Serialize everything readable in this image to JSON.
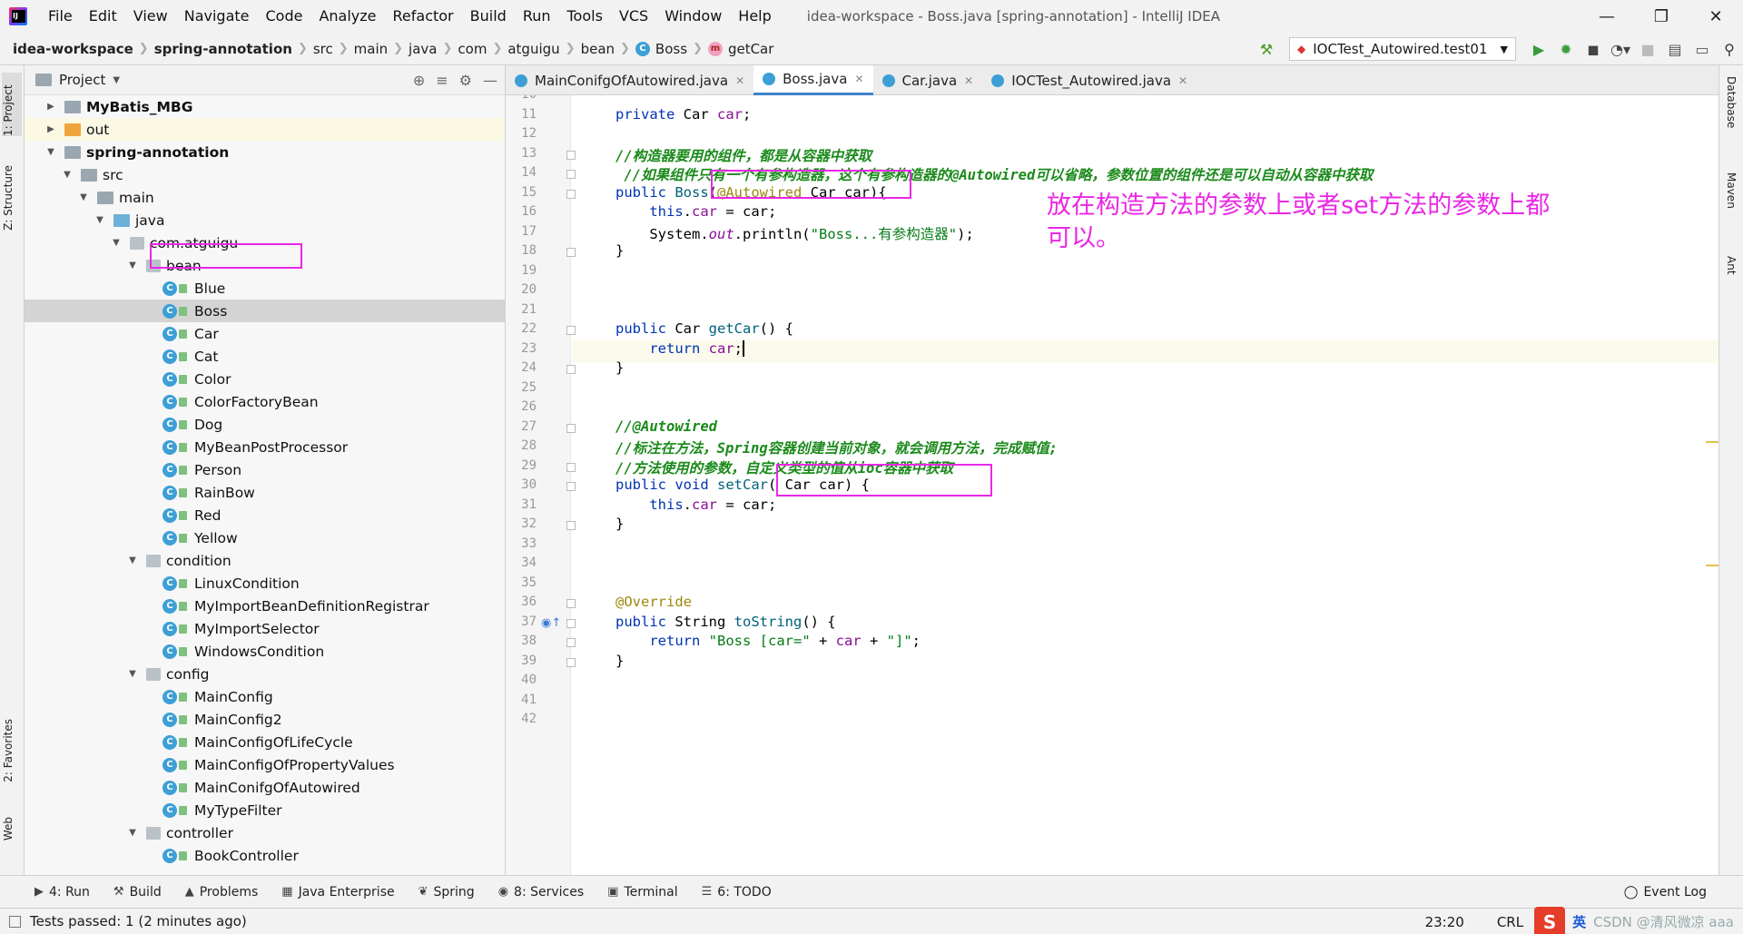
{
  "menu": {
    "items": [
      "File",
      "Edit",
      "View",
      "Navigate",
      "Code",
      "Analyze",
      "Refactor",
      "Build",
      "Run",
      "Tools",
      "VCS",
      "Window",
      "Help"
    ],
    "window_title": "idea-workspace - Boss.java [spring-annotation] - IntelliJ IDEA"
  },
  "breadcrumb": [
    "idea-workspace",
    "spring-annotation",
    "src",
    "main",
    "java",
    "com",
    "atguigu",
    "bean",
    "Boss",
    "getCar"
  ],
  "run_config": "IOCTest_Autowired.test01",
  "project_panel": {
    "title": "Project",
    "tree": [
      {
        "label": "MyBatis_MBG",
        "level": 0,
        "type": "project",
        "arrow": "right",
        "bold": true
      },
      {
        "label": "out",
        "level": 0,
        "type": "folder-orange",
        "arrow": "right",
        "highlight": true
      },
      {
        "label": "spring-annotation",
        "level": 0,
        "type": "project",
        "arrow": "down",
        "bold": true
      },
      {
        "label": "src",
        "level": 1,
        "type": "folder",
        "arrow": "down"
      },
      {
        "label": "main",
        "level": 2,
        "type": "folder",
        "arrow": "down"
      },
      {
        "label": "java",
        "level": 3,
        "type": "folder-blue",
        "arrow": "down"
      },
      {
        "label": "com.atguigu",
        "level": 4,
        "type": "package",
        "arrow": "down"
      },
      {
        "label": "bean",
        "level": 5,
        "type": "package",
        "arrow": "down"
      },
      {
        "label": "Blue",
        "level": 6,
        "type": "class"
      },
      {
        "label": "Boss",
        "level": 6,
        "type": "class",
        "selected": true
      },
      {
        "label": "Car",
        "level": 6,
        "type": "class"
      },
      {
        "label": "Cat",
        "level": 6,
        "type": "class"
      },
      {
        "label": "Color",
        "level": 6,
        "type": "class"
      },
      {
        "label": "ColorFactoryBean",
        "level": 6,
        "type": "class"
      },
      {
        "label": "Dog",
        "level": 6,
        "type": "class"
      },
      {
        "label": "MyBeanPostProcessor",
        "level": 6,
        "type": "class"
      },
      {
        "label": "Person",
        "level": 6,
        "type": "class"
      },
      {
        "label": "RainBow",
        "level": 6,
        "type": "class"
      },
      {
        "label": "Red",
        "level": 6,
        "type": "class"
      },
      {
        "label": "Yellow",
        "level": 6,
        "type": "class"
      },
      {
        "label": "condition",
        "level": 5,
        "type": "package",
        "arrow": "down"
      },
      {
        "label": "LinuxCondition",
        "level": 6,
        "type": "class"
      },
      {
        "label": "MyImportBeanDefinitionRegistrar",
        "level": 6,
        "type": "class"
      },
      {
        "label": "MyImportSelector",
        "level": 6,
        "type": "class"
      },
      {
        "label": "WindowsCondition",
        "level": 6,
        "type": "class"
      },
      {
        "label": "config",
        "level": 5,
        "type": "package",
        "arrow": "down"
      },
      {
        "label": "MainConfig",
        "level": 6,
        "type": "class"
      },
      {
        "label": "MainConfig2",
        "level": 6,
        "type": "class"
      },
      {
        "label": "MainConfigOfLifeCycle",
        "level": 6,
        "type": "class"
      },
      {
        "label": "MainConfigOfPropertyValues",
        "level": 6,
        "type": "class"
      },
      {
        "label": "MainConifgOfAutowired",
        "level": 6,
        "type": "class"
      },
      {
        "label": "MyTypeFilter",
        "level": 6,
        "type": "class"
      },
      {
        "label": "controller",
        "level": 5,
        "type": "package",
        "arrow": "down"
      },
      {
        "label": "BookController",
        "level": 6,
        "type": "class"
      }
    ]
  },
  "tabs": [
    {
      "label": "MainConifgOfAutowired.java",
      "active": false
    },
    {
      "label": "Boss.java",
      "active": true
    },
    {
      "label": "Car.java",
      "active": false
    },
    {
      "label": "IOCTest_Autowired.java",
      "active": false
    }
  ],
  "editor": {
    "first_line": 10,
    "current_line": 23,
    "lines": [
      {
        "n": "10",
        "html": ""
      },
      {
        "n": "11",
        "html": "<span class=\"kw\">private</span> Car <span class=\"fld\">car</span>;"
      },
      {
        "n": "12",
        "html": ""
      },
      {
        "n": "13",
        "html": "<span class=\"cmt\">//构造器要用的组件，都是从容器中获取</span>"
      },
      {
        "n": "14",
        "html": "<span class=\"cmt\"> //如果组件只有一个有参构造器，这个有参构造器的@Autowired可以省略，参数位置的组件还是可以自动从容器中获取</span>"
      },
      {
        "n": "15",
        "html": "<span class=\"kw\">public</span> <span class=\"mth\">Boss</span>(<span class=\"ann\">@Autowired</span> Car car){"
      },
      {
        "n": "16",
        "html": "    <span class=\"kw\">this</span>.<span class=\"fld\">car</span> = car;"
      },
      {
        "n": "17",
        "html": "    System.<span class=\"fld ital\">out</span>.println(<span class=\"str\">\"Boss...有参构造器\"</span>);"
      },
      {
        "n": "18",
        "html": "}"
      },
      {
        "n": "19",
        "html": ""
      },
      {
        "n": "20",
        "html": ""
      },
      {
        "n": "21",
        "html": ""
      },
      {
        "n": "22",
        "html": "<span class=\"kw\">public</span> Car <span class=\"mth\">getCar</span>() {"
      },
      {
        "n": "23",
        "html": "    <span class=\"kw\">return</span> <span class=\"fld\">car</span>;<span class=\"caret\"></span>"
      },
      {
        "n": "24",
        "html": "}"
      },
      {
        "n": "25",
        "html": ""
      },
      {
        "n": "26",
        "html": ""
      },
      {
        "n": "27",
        "html": "<span class=\"cmt\">//@Autowired</span>"
      },
      {
        "n": "28",
        "html": "<span class=\"cmt\">//标注在方法，Spring容器创建当前对象，就会调用方法，完成赋值;</span>"
      },
      {
        "n": "29",
        "html": "<span class=\"cmt\">//方法使用的参数，自定义类型的值从ioc容器中获取</span>"
      },
      {
        "n": "30",
        "html": "<span class=\"kw\">public void</span> <span class=\"mth\">setCar</span>( Car car) {"
      },
      {
        "n": "31",
        "html": "    <span class=\"kw\">this</span>.<span class=\"fld\">car</span> = car;"
      },
      {
        "n": "32",
        "html": "}"
      },
      {
        "n": "33",
        "html": ""
      },
      {
        "n": "34",
        "html": ""
      },
      {
        "n": "35",
        "html": ""
      },
      {
        "n": "36",
        "html": "<span class=\"ann\">@Override</span>"
      },
      {
        "n": "37",
        "html": "<span class=\"kw\">public</span> String <span class=\"mth\">toString</span>() {"
      },
      {
        "n": "38",
        "html": "    <span class=\"kw\">return</span> <span class=\"str\">\"Boss [car=\"</span> + <span class=\"fld\">car</span> + <span class=\"str\">\"]\"</span>;"
      },
      {
        "n": "39",
        "html": "}"
      },
      {
        "n": "40",
        "html": ""
      },
      {
        "n": "41",
        "html": ""
      },
      {
        "n": "42",
        "html": ""
      }
    ]
  },
  "overlay_note": "放在构造方法的参数上或者set方法的参数上都可以。",
  "left_stripe": [
    "1: Project",
    "Z: Structure",
    "2: Favorites",
    "Web"
  ],
  "right_stripe": [
    "Database",
    "Maven",
    "Ant"
  ],
  "bottom_tools": [
    {
      "label": "4: Run",
      "icon": "▶"
    },
    {
      "label": "Build",
      "icon": "⚒"
    },
    {
      "label": "Problems",
      "icon": "▲"
    },
    {
      "label": "Java Enterprise",
      "icon": "▦"
    },
    {
      "label": "Spring",
      "icon": "❦"
    },
    {
      "label": "8: Services",
      "icon": "◉"
    },
    {
      "label": "Terminal",
      "icon": "▣"
    },
    {
      "label": "6: TODO",
      "icon": "☰"
    }
  ],
  "event_log": "Event Log",
  "status": {
    "message": "Tests passed: 1 (2 minutes ago)",
    "position": "23:20",
    "line_sep": "CRL",
    "ime": "英",
    "watermark": "CSDN @清风微凉 aaa"
  },
  "colors": {
    "annotation_pink": "#ea27e5",
    "accent": "#4083c9"
  }
}
